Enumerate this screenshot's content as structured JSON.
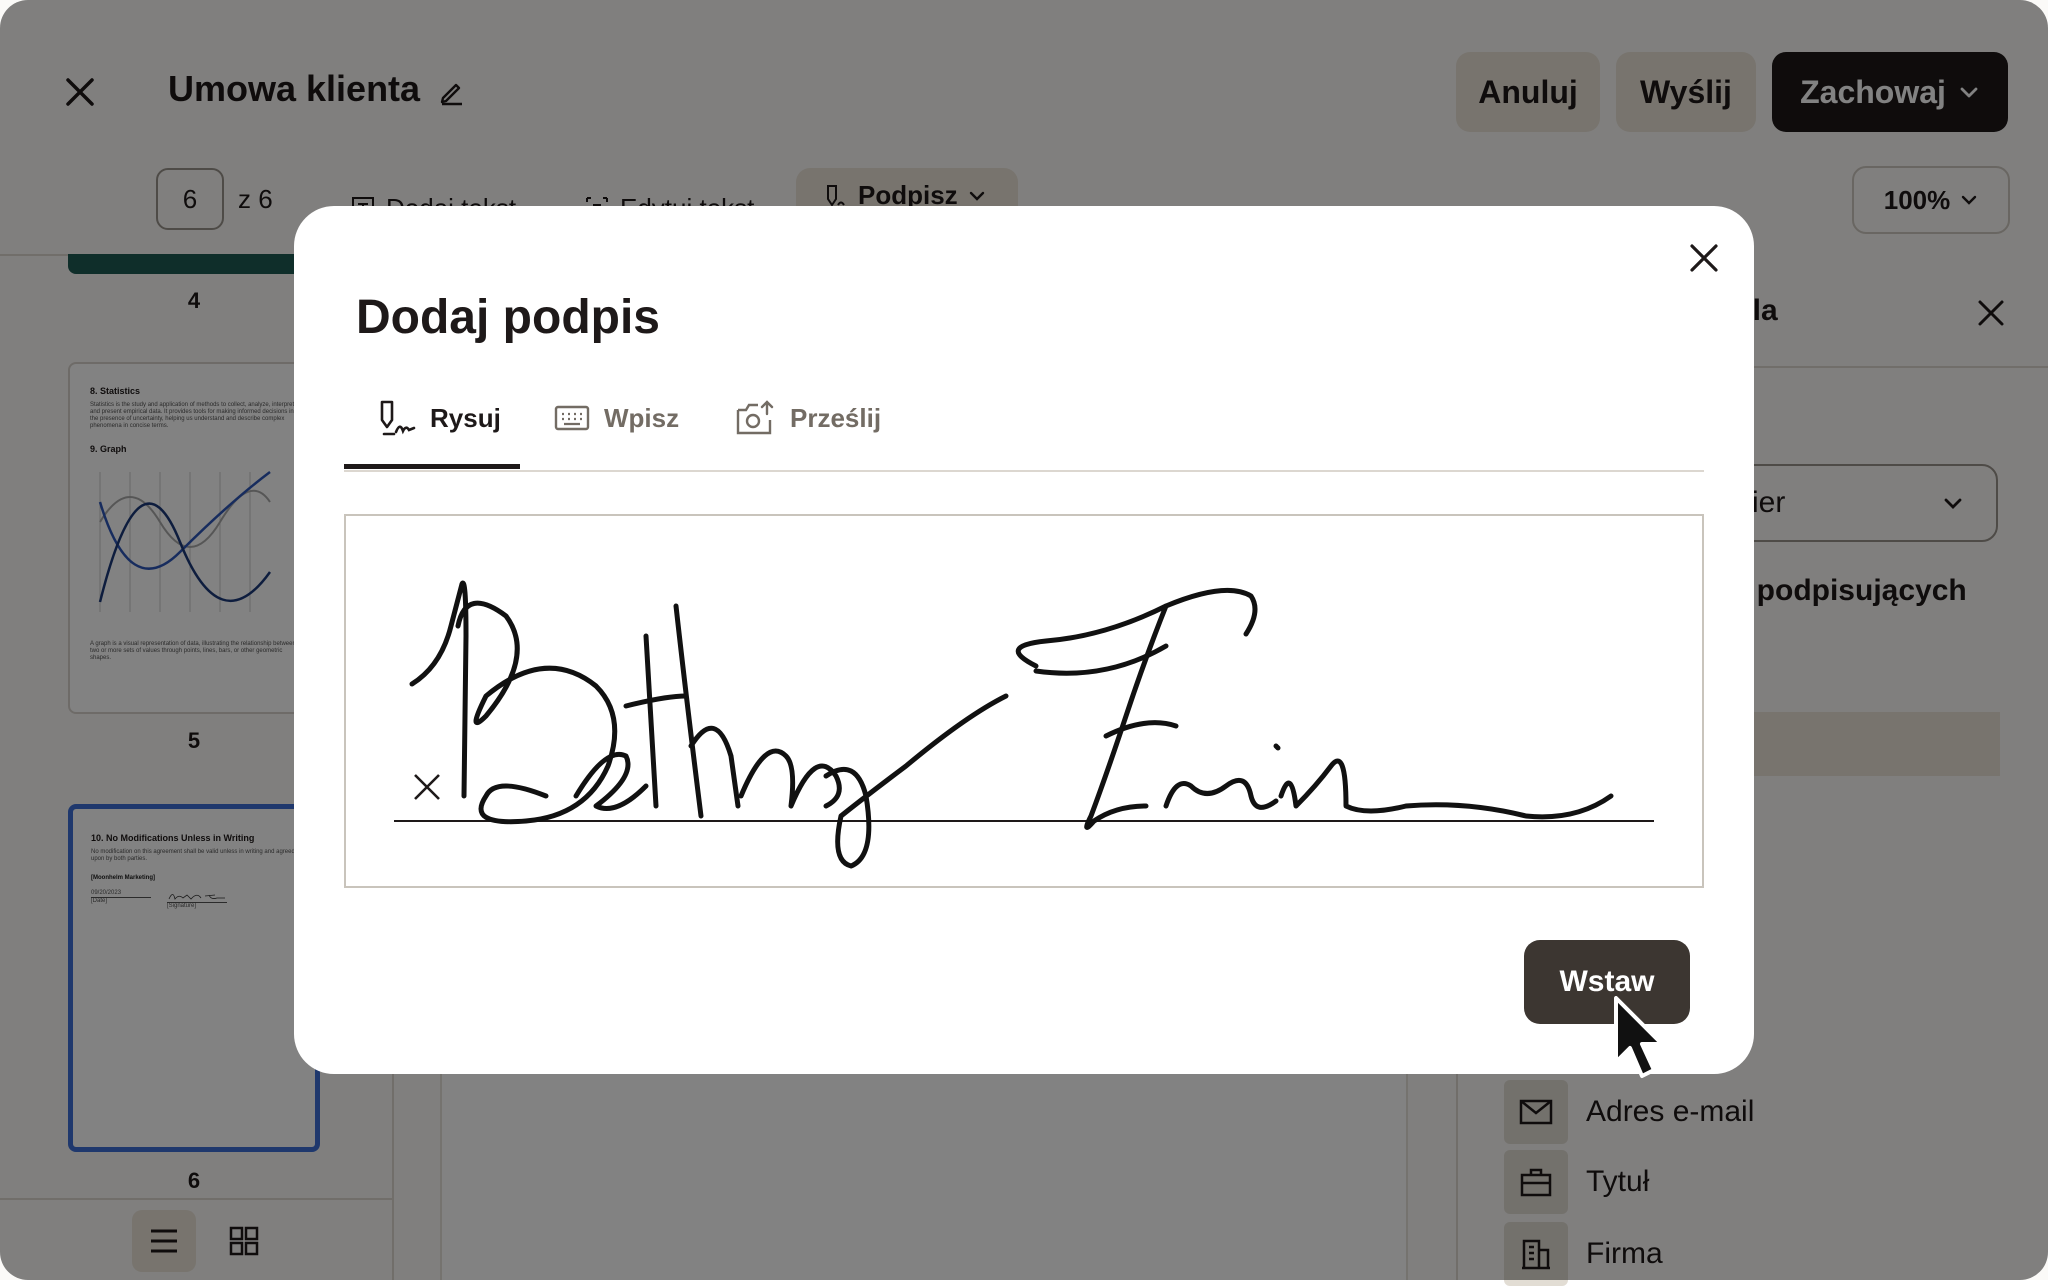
{
  "header": {
    "title": "Umowa klienta",
    "cancel_label": "Anuluj",
    "send_label": "Wyślij",
    "save_label": "Zachowaj"
  },
  "toolbar": {
    "page_current": "6",
    "page_total": "z 6",
    "add_text": "Dodaj tekst",
    "edit_text": "Edytuj tekst",
    "sign": "Podpisz",
    "zoom": "100%"
  },
  "thumbnails": {
    "page4_num": "4",
    "page5_num": "5",
    "page6_num": "6",
    "page5": {
      "heading1": "8. Statistics",
      "para1": "Statistics is the study and application of methods to collect, analyze, interpret and present empirical data. It provides tools for making informed decisions in the presence of uncertainty, helping us understand and describe complex phenomena in concise terms.",
      "heading2": "9. Graph",
      "para2": "A graph is a visual representation of data, illustrating the relationship between two or more sets of values through points, lines, bars, or other geometric shapes."
    },
    "page6": {
      "heading": "10. No Modifications Unless in Writing",
      "para": "No modification on this agreement shall be valid unless in writing and agreed upon by both parties.",
      "company": "[Moonhelm Marketing]",
      "date_value": "09/20/2023",
      "date_label": "[Date]",
      "signature_label": "[Signature]"
    }
  },
  "right_panel": {
    "title_partial": "pola",
    "dropdown_partial": "ier",
    "signers_partial": "j podpisujących",
    "items": [
      {
        "label": "Adres e-mail",
        "icon": "envelope-icon"
      },
      {
        "label": "Tytuł",
        "icon": "briefcase-icon"
      },
      {
        "label": "Firma",
        "icon": "building-icon"
      }
    ]
  },
  "modal": {
    "title": "Dodaj podpis",
    "tabs": [
      {
        "label": "Rysuj",
        "icon": "draw-signature-icon",
        "active": true
      },
      {
        "label": "Wpisz",
        "icon": "keyboard-icon",
        "active": false
      },
      {
        "label": "Prześlij",
        "icon": "camera-upload-icon",
        "active": false
      }
    ],
    "signature_name": "Bethany Frais",
    "insert_label": "Wstaw"
  },
  "colors": {
    "dark_button": "#1e1919",
    "insert_button": "#3c3631",
    "soft_button": "#ebe4d8",
    "selected_thumbnail": "#3d6fd6"
  }
}
